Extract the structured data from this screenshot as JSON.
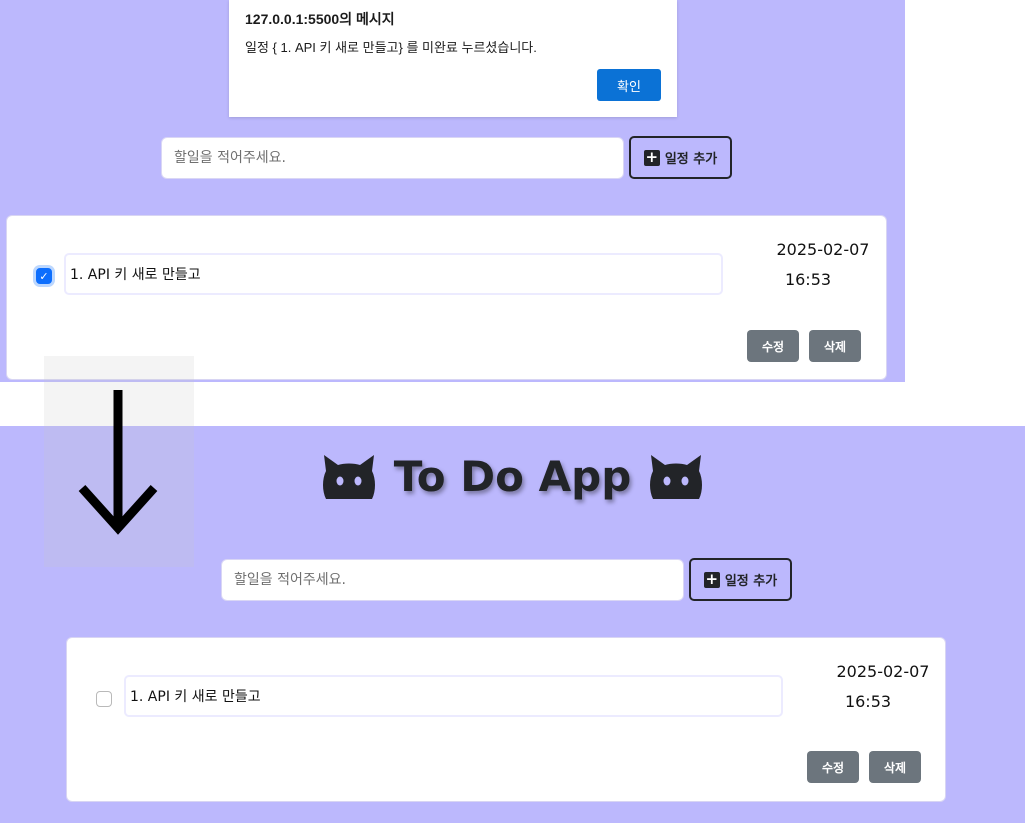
{
  "alert": {
    "title": "127.0.0.1:5500의 메시지",
    "message": "일정 { 1. API 키 새로 만들고} 를 미완료 누르셨습니다.",
    "ok_label": "확인"
  },
  "top": {
    "input_placeholder": "할일을 적어주세요.",
    "add_label": "일정 추가",
    "todo": {
      "checked": true,
      "text": "1. API 키 새로 만들고",
      "date": "2025-02-07",
      "time": "16:53",
      "edit_label": "수정",
      "delete_label": "삭제"
    }
  },
  "bottom": {
    "title": "To Do App",
    "input_placeholder": "할일을 적어주세요.",
    "add_label": "일정 추가",
    "todo": {
      "checked": false,
      "text": "1. API 키 새로 만들고",
      "date": "2025-02-07",
      "time": "16:53",
      "edit_label": "수정",
      "delete_label": "삭제"
    }
  },
  "colors": {
    "background": "#bcb8fd",
    "dark": "#222428",
    "primary": "#0d6efd",
    "alert_button": "#0b72d6",
    "secondary": "#6c757d"
  },
  "icons": [
    "cat-icon",
    "plus-icon",
    "check-icon",
    "arrow-down-icon"
  ]
}
